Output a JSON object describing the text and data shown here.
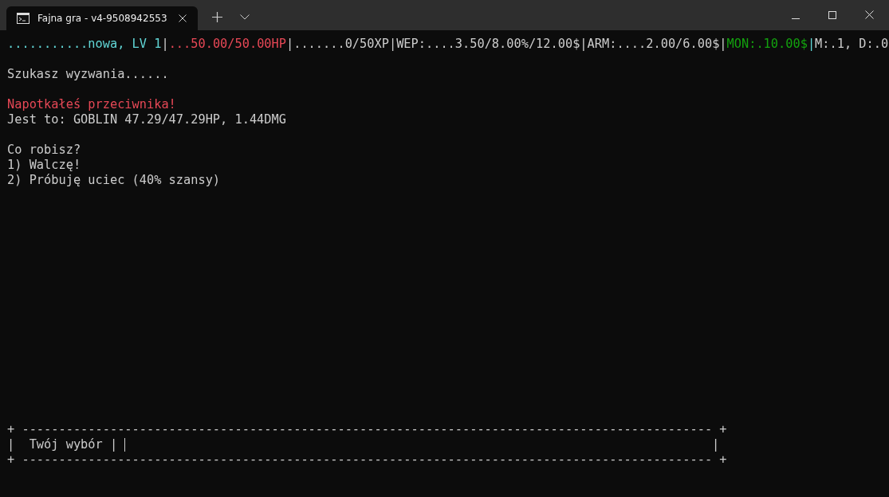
{
  "tab": {
    "title": "Fajna gra - v4-9508942553",
    "selected": true
  },
  "status_line": [
    {
      "text": "...........nowa, LV 1",
      "color": "#61d6d6"
    },
    {
      "text": "|"
    },
    {
      "text": "...50.00/50.00HP",
      "color": "#e74856"
    },
    {
      "text": "|.......0/50XP|WEP:....3.50/8.00%/12.00$|ARM:....2.00/6.00$|"
    },
    {
      "text": "MON:.10.00$",
      "color": "#13a10e"
    },
    {
      "text": "|",
      "color": "#61d6d6"
    },
    {
      "text": "M:.1, D:.0"
    }
  ],
  "blocks": [
    [
      {
        "text": "Szukasz wyzwania......",
        "color": "#cccccc"
      }
    ],
    [
      {
        "text": "Napotkałeś przeciwnika!",
        "color": "#e74856"
      },
      {
        "text": "Jest to: GOBLIN 47.29/47.29HP, 1.44DMG",
        "color": "#cccccc"
      }
    ],
    [
      {
        "text": "Co robisz?",
        "color": "#cccccc"
      },
      {
        "text": "1) Walczę!",
        "color": "#cccccc"
      },
      {
        "text": "2) Próbuję uciec (40% szansy)",
        "color": "#cccccc"
      }
    ]
  ],
  "input_box": {
    "top_border": "+ ---------------------------------------------------------------------------------------------- +",
    "left_edge": "|",
    "prompt": "Twój wybór |",
    "right_edge": "|",
    "bottom_border": "+ ---------------------------------------------------------------------------------------------- +"
  }
}
